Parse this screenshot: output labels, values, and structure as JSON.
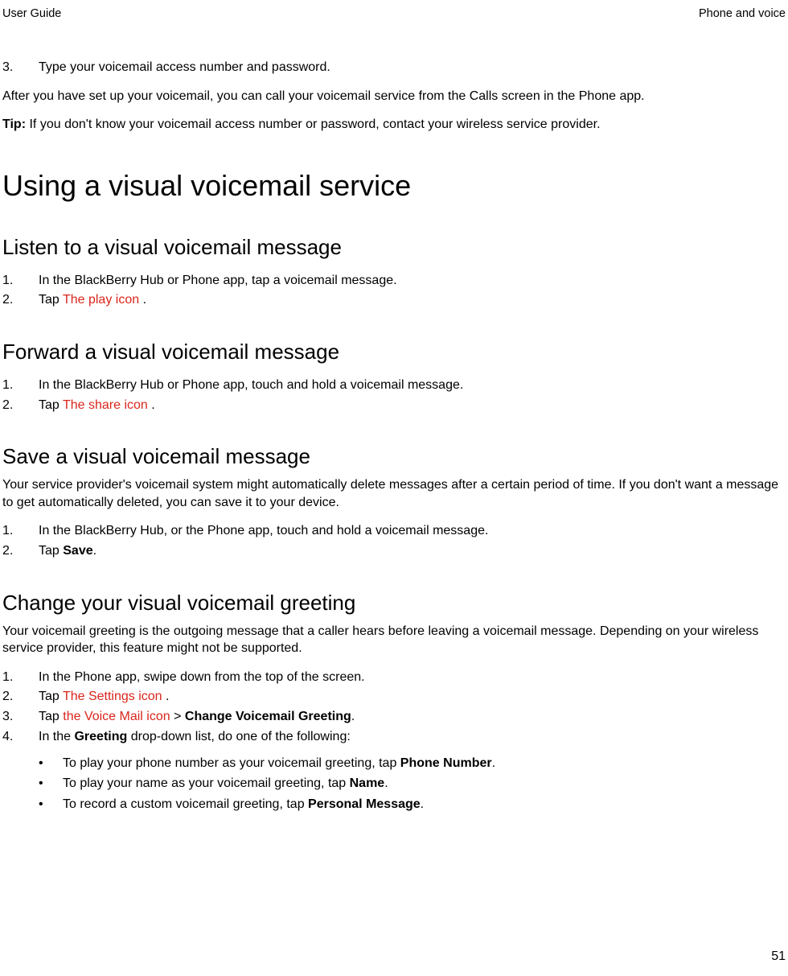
{
  "header": {
    "left": "User Guide",
    "right": "Phone and voice"
  },
  "top_list": {
    "item3_marker": "3.",
    "item3_text": "Type your voicemail access number and password."
  },
  "top_para": "After you have set up your voicemail, you can call your voicemail service from the Calls screen in the Phone app.",
  "tip": {
    "label": "Tip: ",
    "text": "If you don't know your voicemail access number or password, contact your wireless service provider."
  },
  "h1": "Using a visual voicemail service",
  "section_listen": {
    "heading": "Listen to a visual voicemail message",
    "items": [
      {
        "marker": "1.",
        "text": "In the BlackBerry Hub or Phone app, tap a voicemail message."
      },
      {
        "marker": "2.",
        "prefix": "Tap ",
        "icon": " The play icon ",
        "suffix": "."
      }
    ]
  },
  "section_forward": {
    "heading": "Forward a visual voicemail message",
    "items": [
      {
        "marker": "1.",
        "text": "In the BlackBerry Hub or Phone app, touch and hold a voicemail message."
      },
      {
        "marker": "2.",
        "prefix": "Tap ",
        "icon": " The share icon ",
        "suffix": "."
      }
    ]
  },
  "section_save": {
    "heading": "Save a visual voicemail message",
    "intro": "Your service provider's voicemail system might automatically delete messages after a certain period of time. If you don't want a message to get automatically deleted, you can save it to your device.",
    "items": [
      {
        "marker": "1.",
        "text": "In the BlackBerry Hub, or the Phone app, touch and hold a voicemail message."
      },
      {
        "marker": "2.",
        "prefix": "Tap ",
        "bold": "Save",
        "suffix": "."
      }
    ]
  },
  "section_change": {
    "heading": "Change your visual voicemail greeting",
    "intro": "Your voicemail greeting is the outgoing message that a caller hears before leaving a voicemail message. Depending on your wireless service provider, this feature might not be supported.",
    "items": {
      "i1": {
        "marker": "1.",
        "text": "In the Phone app, swipe down from the top of the screen."
      },
      "i2": {
        "marker": "2.",
        "prefix": "Tap ",
        "icon": " The Settings icon ",
        "suffix": "."
      },
      "i3": {
        "marker": "3.",
        "prefix": "Tap ",
        "icon": " the Voice Mail icon ",
        "mid": "  > ",
        "bold": "Change Voicemail Greeting",
        "suffix": "."
      },
      "i4": {
        "marker": "4.",
        "prefix": "In the ",
        "bold": "Greeting",
        "suffix": " drop-down list, do one of the following:"
      }
    },
    "bullets": {
      "b1": {
        "prefix": "To play your phone number as your voicemail greeting, tap ",
        "bold": "Phone Number",
        "suffix": "."
      },
      "b2": {
        "prefix": "To play your name as your voicemail greeting, tap ",
        "bold": "Name",
        "suffix": "."
      },
      "b3": {
        "prefix": "To record a custom voicemail greeting, tap ",
        "bold": "Personal Message",
        "suffix": "."
      }
    }
  },
  "page_number": "51"
}
